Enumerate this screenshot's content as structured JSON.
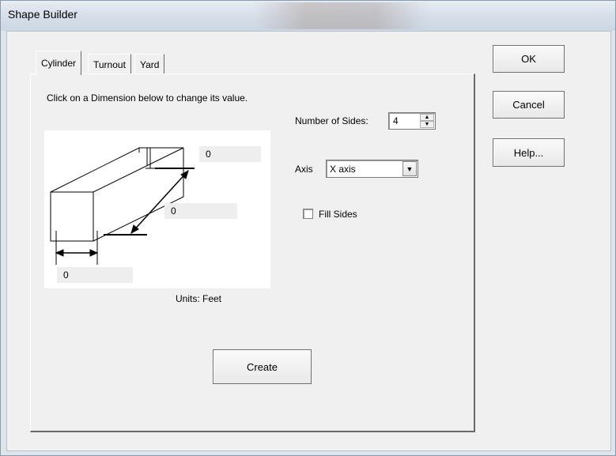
{
  "window": {
    "title": "Shape Builder"
  },
  "buttons": {
    "ok": "OK",
    "cancel": "Cancel",
    "help": "Help...",
    "create": "Create"
  },
  "tabs": [
    {
      "label": "Cylinder",
      "active": true
    },
    {
      "label": "Turnout",
      "active": false
    },
    {
      "label": "Yard",
      "active": false
    }
  ],
  "instructions": "Click on a Dimension below to change its value.",
  "dimensions": {
    "height": "0",
    "length": "0",
    "width": "0"
  },
  "units_label": "Units: Feet",
  "sides": {
    "label": "Number of Sides:",
    "value": "4"
  },
  "axis": {
    "label": "Axis",
    "value": "X axis"
  },
  "fill_sides": {
    "label": "Fill Sides",
    "checked": false
  },
  "icons": {
    "spinner_up": "triangle-up",
    "spinner_down": "triangle-down",
    "dropdown": "chevron-down"
  }
}
